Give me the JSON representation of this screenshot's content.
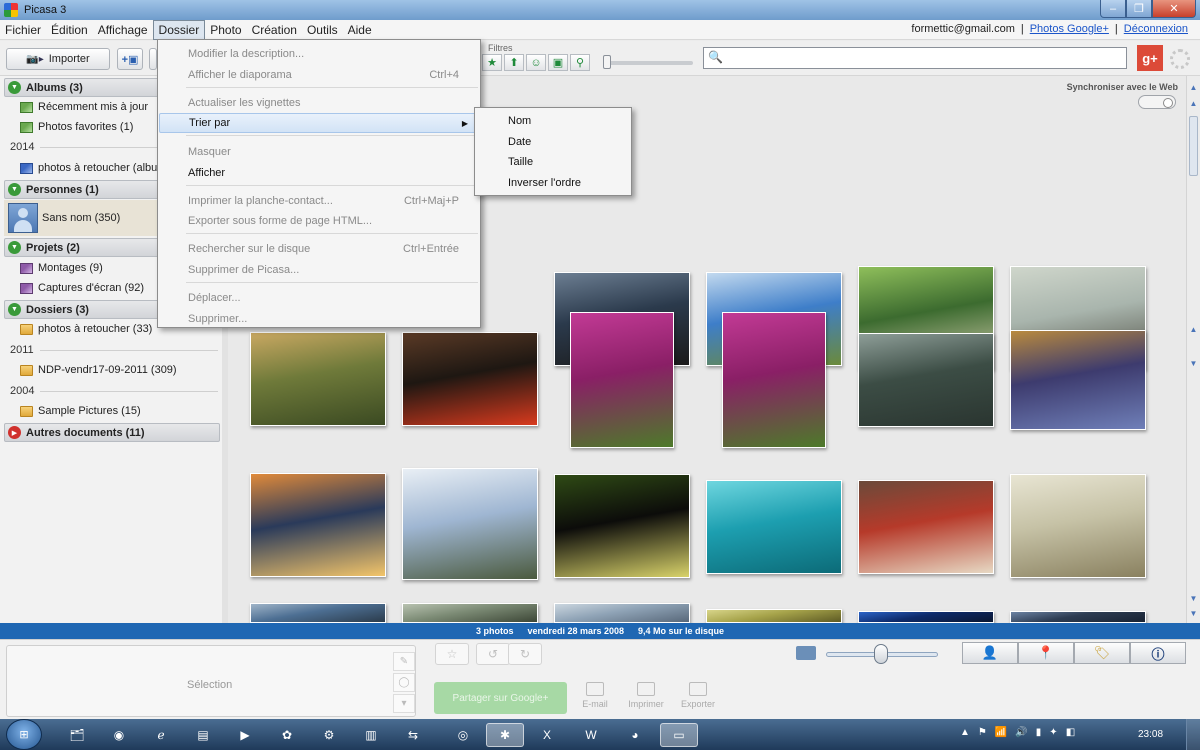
{
  "window": {
    "title": "Picasa 3"
  },
  "menubar": {
    "items": [
      "Fichier",
      "Édition",
      "Affichage",
      "Dossier",
      "Photo",
      "Création",
      "Outils",
      "Aide"
    ],
    "open_menu": "Dossier"
  },
  "account": {
    "email": "formettic@gmail.com",
    "sep1": "|",
    "photos_link": "Photos Google+",
    "sep2": "|",
    "logout": "Déconnexion"
  },
  "toolbar": {
    "import_label": "Importer",
    "filters_label": "Filtres",
    "search_placeholder": ""
  },
  "dossier_menu": {
    "items": [
      {
        "label": "Modifier la description...",
        "shortcut": "",
        "enabled": false
      },
      {
        "label": "Afficher le diaporama",
        "shortcut": "Ctrl+4",
        "enabled": false
      },
      {
        "label": "Actualiser les vignettes",
        "shortcut": "",
        "enabled": false
      },
      {
        "label": "Trier par",
        "shortcut": "",
        "enabled": true,
        "submenu": true
      },
      {
        "label": "Masquer",
        "shortcut": "",
        "enabled": false
      },
      {
        "label": "Afficher",
        "shortcut": "",
        "enabled": true
      },
      {
        "label": "Imprimer la planche-contact...",
        "shortcut": "Ctrl+Maj+P",
        "enabled": false
      },
      {
        "label": "Exporter sous forme de page HTML...",
        "shortcut": "",
        "enabled": false
      },
      {
        "label": "Rechercher sur le disque",
        "shortcut": "Ctrl+Entrée",
        "enabled": false
      },
      {
        "label": "Supprimer de Picasa...",
        "shortcut": "",
        "enabled": false
      },
      {
        "label": "Déplacer...",
        "shortcut": "",
        "enabled": false
      },
      {
        "label": "Supprimer...",
        "shortcut": "",
        "enabled": false
      }
    ],
    "sort_submenu": [
      "Nom",
      "Date",
      "Taille",
      "Inverser l'ordre"
    ]
  },
  "sidebar": {
    "sections": [
      {
        "title": "Albums (3)",
        "state": "open"
      },
      {
        "title": "Personnes (1)",
        "state": "open"
      },
      {
        "title": "Projets (2)",
        "state": "open"
      },
      {
        "title": "Dossiers (3)",
        "state": "open"
      },
      {
        "title": "Autres documents (11)",
        "state": "closed"
      }
    ],
    "albums": [
      "Récemment mis à jour",
      "Photos favorites (1)"
    ],
    "year_2014": "2014",
    "web_album": "photos à retoucher (album web)",
    "person": "Sans nom (350)",
    "projects": [
      "Montages (9)",
      "Captures d'écran (92)"
    ],
    "folders": [
      {
        "label": "photos à retoucher (33)"
      },
      {
        "year": "2011",
        "label": "NDP-vendr17-09-2011 (309)"
      },
      {
        "year": "2004",
        "label": "Sample Pictures (15)"
      }
    ]
  },
  "library": {
    "sync_label": "Synchroniser avec le Web",
    "thumbnails": [
      {
        "desc": "river-landscape",
        "colors": [
          "#5e6b52",
          "#a7b7a2",
          "#3d4a3a"
        ]
      },
      {
        "desc": "elephant-dusk",
        "colors": [
          "#2b3a4c",
          "#6c7e92",
          "#1b1a1a"
        ]
      },
      {
        "desc": "kilimanjaro",
        "colors": [
          "#3e7ec9",
          "#c2d9ef",
          "#6b8a3b"
        ]
      },
      {
        "desc": "zebras",
        "colors": [
          "#3c6b2f",
          "#8fbf5b",
          "#d8d0b2"
        ]
      },
      {
        "desc": "elephants-eagle",
        "colors": [
          "#a9b5ad",
          "#cfd6cb",
          "#4b4a3f"
        ]
      },
      {
        "desc": "cheetahs",
        "colors": [
          "#6f7a3a",
          "#c9a862",
          "#3b4a22"
        ]
      },
      {
        "desc": "hands-rose",
        "colors": [
          "#1e1712",
          "#5a3a26",
          "#d83a1e"
        ]
      },
      {
        "desc": "tulips-1",
        "colors": [
          "#8a1f66",
          "#c23a95",
          "#4d7a2a"
        ]
      },
      {
        "desc": "tulips-2",
        "colors": [
          "#8a1f66",
          "#c23a95",
          "#4d7a2a"
        ]
      },
      {
        "desc": "marsh-mist",
        "colors": [
          "#3c4d45",
          "#8e9e98",
          "#2a3530"
        ]
      },
      {
        "desc": "lion-reflection",
        "colors": [
          "#3d3b6e",
          "#b98a3e",
          "#6f7fb8"
        ]
      },
      {
        "desc": "sunset-lake",
        "colors": [
          "#2a3a5a",
          "#e08a3a",
          "#f3c56a"
        ]
      },
      {
        "desc": "lake-rocks",
        "colors": [
          "#9fb6d2",
          "#e9eff5",
          "#4b5a3e"
        ]
      },
      {
        "desc": "macro-tendril",
        "colors": [
          "#0c0c0a",
          "#2f4a15",
          "#d9d36a"
        ]
      },
      {
        "desc": "manatee",
        "colors": [
          "#1d9fb0",
          "#6ed6df",
          "#0c6b78"
        ]
      },
      {
        "desc": "masai-woman",
        "colors": [
          "#b63a2a",
          "#6b4a3a",
          "#e7d9c4"
        ]
      },
      {
        "desc": "cheetah-cubs",
        "colors": [
          "#c6c2a6",
          "#e8e5d3",
          "#8a8160"
        ]
      },
      {
        "desc": "partial-1",
        "colors": [
          "#4d6f93",
          "#9fb4c8",
          "#2b3b4b"
        ]
      },
      {
        "desc": "partial-2",
        "colors": [
          "#7b8a74",
          "#b8c2b0",
          "#3c4636"
        ]
      },
      {
        "desc": "partial-3",
        "colors": [
          "#8fa3b6",
          "#cbd6df",
          "#58687a"
        ]
      },
      {
        "desc": "partial-4",
        "colors": [
          "#a6a34a",
          "#d8d58a",
          "#5d5a24"
        ]
      },
      {
        "desc": "partial-5",
        "colors": [
          "#0d2a6a",
          "#2b64c8",
          "#0a1630"
        ]
      },
      {
        "desc": "partial-6",
        "colors": [
          "#2d3c52",
          "#6c83a3",
          "#182232"
        ]
      }
    ]
  },
  "statusbar": {
    "count": "3 photos",
    "date": "vendredi 28 mars 2008",
    "size": "9,4 Mo sur le disque"
  },
  "tray": {
    "selection_label": "Sélection",
    "share_label": "Partager sur Google+",
    "actions": [
      "E-mail",
      "Imprimer",
      "Exporter"
    ]
  },
  "taskbar": {
    "start": "Démarrer",
    "clock": "23:08"
  },
  "colors": {
    "accent": "#1f67b3",
    "menu_highlight": "#d2e3f6",
    "window_frame": "#6f9ccc"
  }
}
